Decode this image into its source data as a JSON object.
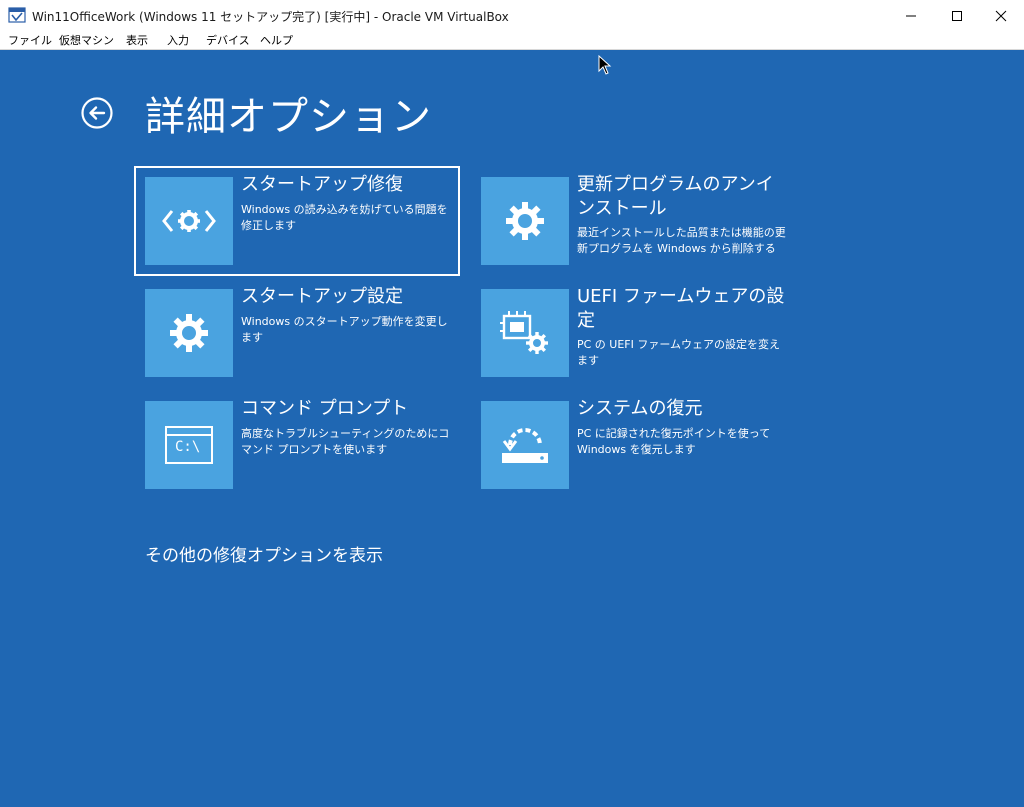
{
  "window": {
    "title": "Win11OfficeWork (Windows 11 セットアップ完了) [実行中] - Oracle VM VirtualBox"
  },
  "menu": [
    "ファイル",
    "仮想マシン",
    "表示",
    "入力",
    "デバイス",
    "ヘルプ"
  ],
  "page": {
    "title": "詳細オプション",
    "more_options": "その他の修復オプションを表示"
  },
  "tiles": [
    {
      "title": "スタートアップ修復",
      "desc": "Windows の読み込みを妨げている問題を修正します",
      "icon": "startup-repair-icon"
    },
    {
      "title": "更新プログラムのアンインストール",
      "desc": "最近インストールした品質または機能の更新プログラムを Windows から削除する",
      "icon": "gear-icon"
    },
    {
      "title": "スタートアップ設定",
      "desc": "Windows のスタートアップ動作を変更します",
      "icon": "gear-icon"
    },
    {
      "title": "UEFI ファームウェアの設定",
      "desc": "PC の UEFI ファームウェアの設定を変えます",
      "icon": "firmware-chip-icon"
    },
    {
      "title": "コマンド プロンプト",
      "desc": "高度なトラブルシューティングのためにコマンド プロンプトを使います",
      "icon": "command-prompt-icon"
    },
    {
      "title": "システムの復元",
      "desc": "PC に記録された復元ポイントを使って Windows を復元します",
      "icon": "system-restore-icon"
    }
  ],
  "cmd_icon_text": "C:\\",
  "colors": {
    "background": "#1f67b3",
    "tile_icon_bg": "#4aa3e0",
    "text": "#ffffff"
  }
}
